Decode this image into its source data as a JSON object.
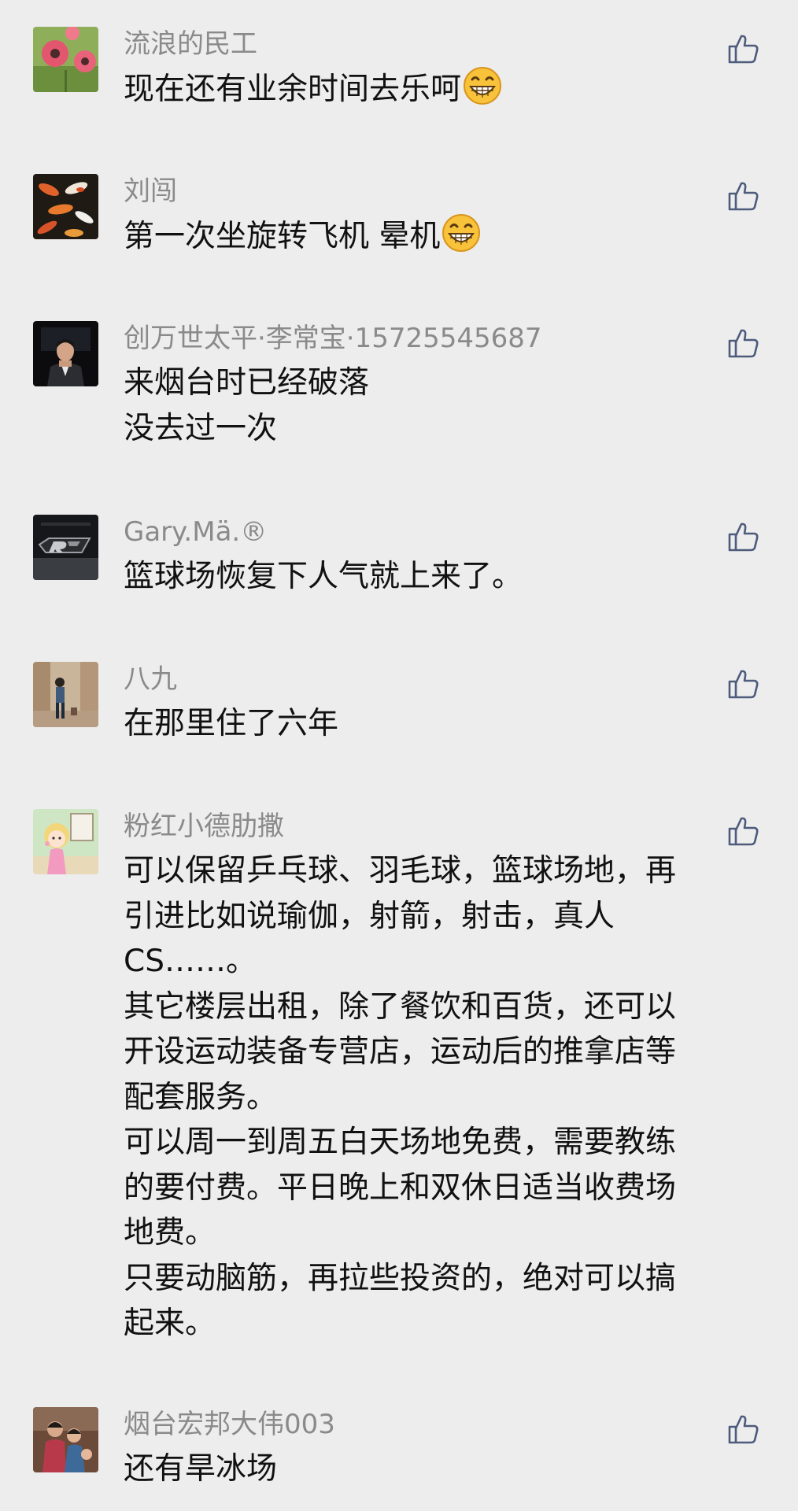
{
  "colors": {
    "background": "#ededed",
    "name_text": "#8a8a8a",
    "comment_text": "#111111",
    "like_icon": "#4d5b7c"
  },
  "comments": [
    {
      "name": "流浪的民工",
      "avatar_icon": "pink-flowers-avatar",
      "lines": [
        "现在还有业余时间去乐呵"
      ],
      "emoji": "grinning-face-icon",
      "like_icon": "thumbs-up-icon"
    },
    {
      "name": "刘闯",
      "avatar_icon": "koi-fish-avatar",
      "lines": [
        "第一次坐旋转飞机 晕机"
      ],
      "emoji": "grinning-face-icon",
      "like_icon": "thumbs-up-icon"
    },
    {
      "name": "创万世太平·李常宝·15725545687",
      "avatar_icon": "man-in-suit-avatar",
      "lines": [
        "来烟台时已经破落",
        "没去过一次"
      ],
      "like_icon": "thumbs-up-icon"
    },
    {
      "name": "Gary.Mä.®",
      "avatar_icon": "car-logo-avatar",
      "lines": [
        "篮球场恢复下人气就上来了。"
      ],
      "like_icon": "thumbs-up-icon"
    },
    {
      "name": "八九",
      "avatar_icon": "person-standing-avatar",
      "lines": [
        "在那里住了六年"
      ],
      "like_icon": "thumbs-up-icon"
    },
    {
      "name": "粉红小德肋撒",
      "avatar_icon": "cartoon-girl-avatar",
      "lines": [
        "可以保留乒乓球、羽毛球，篮球场地，再",
        "引进比如说瑜伽，射箭，射击，真人",
        "CS……。",
        "其它楼层出租，除了餐饮和百货，还可以",
        "开设运动装备专营店，运动后的推拿店等",
        "配套服务。",
        "可以周一到周五白天场地免费，需要教练",
        "的要付费。平日晚上和双休日适当收费场",
        "地费。",
        "只要动脑筋，再拉些投资的，绝对可以搞",
        "起来。"
      ],
      "like_icon": "thumbs-up-icon"
    },
    {
      "name": "烟台宏邦大伟003",
      "avatar_icon": "family-photo-avatar",
      "lines": [
        "还有旱冰场"
      ],
      "like_icon": "thumbs-up-icon"
    }
  ]
}
